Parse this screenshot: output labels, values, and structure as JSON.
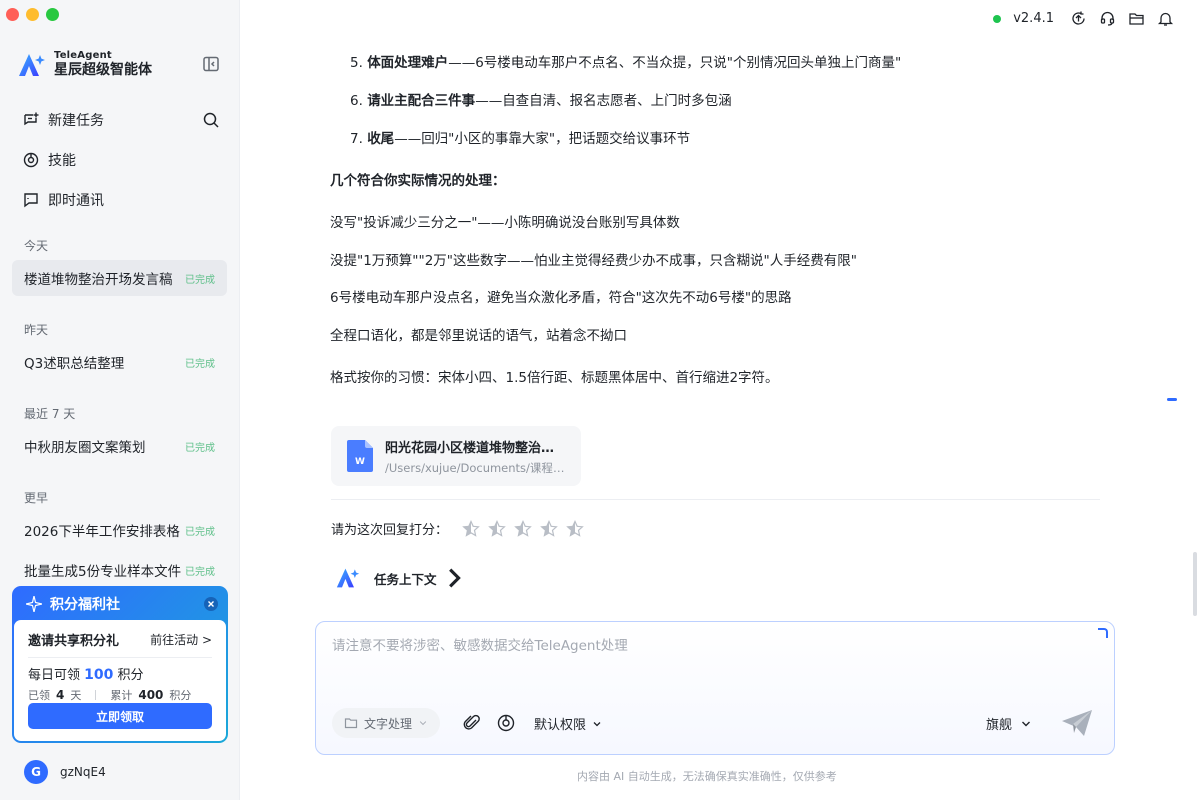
{
  "window": {
    "traffic_colors": [
      "#ff5f57",
      "#febc2e",
      "#28c840"
    ]
  },
  "brand": {
    "en": "TeleAgent",
    "cn": "星辰超级智能体"
  },
  "nav": {
    "new_task": "新建任务",
    "skills": "技能",
    "im": "即时通讯"
  },
  "history": {
    "today_label": "今天",
    "yesterday_label": "昨天",
    "week_label": "最近 7 天",
    "earlier_label": "更早",
    "items": [
      {
        "title": "楼道堆物整治开场发言稿",
        "status": "已完成"
      },
      {
        "title": "Q3述职总结整理",
        "status": "已完成"
      },
      {
        "title": "中秋朋友圈文案策划",
        "status": "已完成"
      },
      {
        "title": "2026下半年工作安排表格",
        "status": "已完成"
      },
      {
        "title": "批量生成5份专业样本文件",
        "status": "已完成"
      }
    ]
  },
  "promo": {
    "title": "积分福利社",
    "invite": "邀请共享积分礼",
    "goto": "前往活动 >",
    "daily_prefix": "每日可领",
    "daily_value": "100",
    "daily_suffix": "积分",
    "claimed_label": "已领",
    "claimed_value": "4",
    "claimed_unit": "天",
    "total_label": "累计",
    "total_value": "400",
    "total_unit": "积分",
    "button": "立即领取"
  },
  "user": {
    "initial": "G",
    "name": "gzNqE4"
  },
  "topbar": {
    "version": "v2.4.1",
    "status_color": "#1ec44f"
  },
  "message": {
    "list_items": [
      {
        "num": "5.",
        "bold": "体面处理难户",
        "rest": "——6号楼电动车那户不点名、不当众提，只说\"个别情况回头单独上门商量\""
      },
      {
        "num": "6.",
        "bold": "请业主配合三件事",
        "rest": "——自查自清、报名志愿者、上门时多包涵"
      },
      {
        "num": "7.",
        "bold": "收尾",
        "rest": "——回归\"小区的事靠大家\"，把话题交给议事环节"
      }
    ],
    "heading": "几个符合你实际情况的处理：",
    "paras": [
      "没写\"投诉减少三分之一\"——小陈明确说没台账别写具体数",
      "没提\"1万预算\"\"2万\"这些数字——怕业主觉得经费少办不成事，只含糊说\"人手经费有限\"",
      "6号楼电动车那户没点名，避免当众激化矛盾，符合\"这次先不动6号楼\"的思路",
      "全程口语化，都是邻里说话的语气，站着念不拗口",
      "格式按你的习惯：宋体小四、1.5倍行距、标题黑体居中、首行缩进2字符。"
    ]
  },
  "file": {
    "name": "阳光花园小区楼道堆物整治开场发言稿.docx",
    "path": "/Users/xujue/Documents/课程资料",
    "icon_letter": "W"
  },
  "rating": {
    "label": "请为这次回复打分：",
    "stars": 5
  },
  "context": {
    "label": "任务上下文"
  },
  "composer": {
    "placeholder": "请注意不要将涉密、敏感数据交给TeleAgent处理",
    "mode": "文字处理",
    "permission": "默认权限",
    "model": "旗舰"
  },
  "footnote": "内容由 AI 自动生成，无法确保真实准确性，仅供参考",
  "colors": {
    "accent": "#2f6bff",
    "done": "#5fc08a"
  }
}
